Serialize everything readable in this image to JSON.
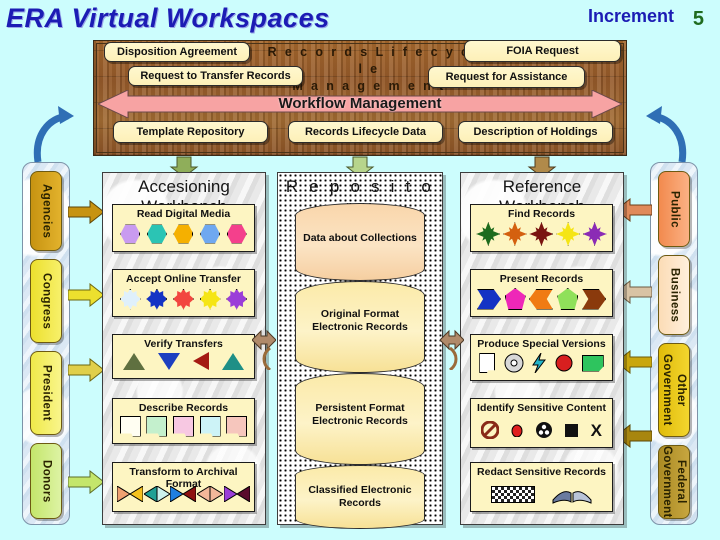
{
  "header": {
    "title": "ERA Virtual Workspaces",
    "increment_label": "Increment",
    "increment_number": "5"
  },
  "top_panel": {
    "heading_line1": "R e c o r d s   L i f e c y c l e",
    "heading_line2": "M a n a g e m e n t",
    "workflow_label": "Workflow Management",
    "callouts": [
      {
        "id": "disposition-agreement",
        "label": "Disposition Agreement"
      },
      {
        "id": "request-to-transfer-records",
        "label": "Request to Transfer Records"
      },
      {
        "id": "foia-request",
        "label": "FOIA Request"
      },
      {
        "id": "request-for-assistance",
        "label": "Request for Assistance"
      }
    ],
    "data_stores": [
      {
        "id": "template-repository",
        "label": "Template Repository"
      },
      {
        "id": "records-lifecycle-data",
        "label": "Records Lifecycle Data"
      },
      {
        "id": "description-of-holdings",
        "label": "Description of Holdings"
      }
    ]
  },
  "left_actors": [
    {
      "id": "agencies",
      "label": "Agencies",
      "color": "#d4a017"
    },
    {
      "id": "congress",
      "label": "Congress",
      "color": "#f2e235"
    },
    {
      "id": "president",
      "label": "President",
      "color": "#f4ee4e"
    },
    {
      "id": "donors",
      "label": "Donors",
      "color": "#ccea73"
    }
  ],
  "right_actors": [
    {
      "id": "public",
      "label": "Public",
      "color": "#f79a63"
    },
    {
      "id": "business",
      "label": "Business",
      "color": "#fbd9b0"
    },
    {
      "id": "other-government",
      "label": "Other Government",
      "color": "#e8c20c"
    },
    {
      "id": "federal-government",
      "label": "Federal Government",
      "color": "#b8962a"
    }
  ],
  "columns": [
    {
      "id": "accessioning-workbench",
      "title_line1": "Accesioning",
      "title_line2": "Workbench",
      "tasks": [
        {
          "id": "read-digital-media",
          "label": "Read Digital Media"
        },
        {
          "id": "accept-online-transfer",
          "label": "Accept Online Transfer"
        },
        {
          "id": "verify-transfers",
          "label": "Verify Transfers"
        },
        {
          "id": "describe-records",
          "label": "Describe Records"
        },
        {
          "id": "transform-to-archival-format",
          "label": "Transform to Archival Format"
        }
      ]
    },
    {
      "id": "repository",
      "title_line1": "R e p o s i t o r y",
      "title_line2": "",
      "stores": [
        {
          "id": "data-about-collections",
          "label": "Data about Collections"
        },
        {
          "id": "original-format-electronic-records",
          "label": "Original Format Electronic Records"
        },
        {
          "id": "persistent-format-electronic-records",
          "label": "Persistent Format Electronic Records"
        },
        {
          "id": "classified-electronic-records",
          "label": "Classified Electronic Records"
        }
      ]
    },
    {
      "id": "reference-workbench",
      "title_line1": "Reference",
      "title_line2": "Workbench",
      "tasks": [
        {
          "id": "find-records",
          "label": "Find Records"
        },
        {
          "id": "present-records",
          "label": "Present Records"
        },
        {
          "id": "produce-special-versions",
          "label": "Produce Special Versions"
        },
        {
          "id": "identify-sensitive-content",
          "label": "Identify Sensitive Content"
        },
        {
          "id": "redact-sensitive-records",
          "label": "Redact Sensitive Records"
        }
      ]
    }
  ],
  "colors": {
    "background": "#ccfdfd",
    "title_blue": "#1c1cb4",
    "increment_green": "#1f6b1f",
    "wood_brown": "#94592a",
    "callout_yellow": "#fdf0b8",
    "pink_arrow": "#f7a3a3",
    "cylinder_top": "#f8cfa0",
    "cylinder_body": "#fbe9a6"
  }
}
